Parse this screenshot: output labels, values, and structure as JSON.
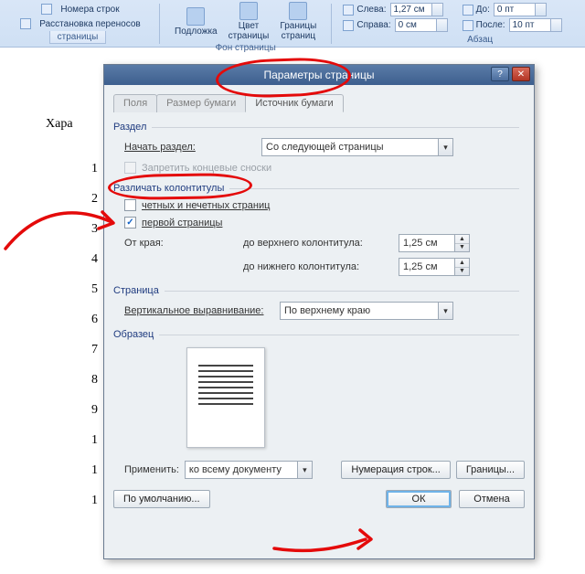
{
  "ribbon": {
    "col_linenums": "Номера строк",
    "col_hyphen": "Расстановка переносов",
    "group_page": "страницы",
    "watermark": "Подложка",
    "pagecolor": "Цвет\nстраницы",
    "borders_btn": "Границы\nстраниц",
    "group_bg": "Фон страницы",
    "left_lbl": "Слева:",
    "left_val": "1,27 см",
    "right_lbl": "Справа:",
    "right_val": "0 см",
    "before_lbl": "До:",
    "before_val": "0 пт",
    "after_lbl": "После:",
    "after_val": "10 пт",
    "group_para": "Абзац"
  },
  "doc": {
    "word": "Хара",
    "nums": [
      "1",
      "2",
      "3",
      "4",
      "5",
      "6",
      "7",
      "8",
      "9",
      "1",
      "1",
      "1"
    ]
  },
  "dialog": {
    "title": "Параметры страницы",
    "help": "?",
    "close": "✕",
    "tabs": {
      "fields": "Поля",
      "size": "Размер бумаги",
      "source": "Источник бумаги"
    },
    "section_group": "Раздел",
    "start_section_lbl": "Начать раздел:",
    "start_section_val": "Со следующей страницы",
    "suppress_endnotes": "Запретить концевые сноски",
    "headers_group": "Различать колонтитулы",
    "odd_even": "четных и нечетных страниц",
    "first_page": "первой страницы",
    "from_edge": "От края:",
    "to_header": "до верхнего колонтитула:",
    "to_footer": "до нижнего колонтитула:",
    "to_header_val": "1,25 см",
    "to_footer_val": "1,25 см",
    "page_group": "Страница",
    "valign_lbl": "Вертикальное выравнивание:",
    "valign_val": "По верхнему краю",
    "preview_group": "Образец",
    "apply_lbl": "Применить:",
    "apply_val": "ко всему документу",
    "line_numbers_btn": "Нумерация строк...",
    "borders_btn": "Границы...",
    "default_btn": "По умолчанию...",
    "ok": "ОК",
    "cancel": "Отмена"
  }
}
